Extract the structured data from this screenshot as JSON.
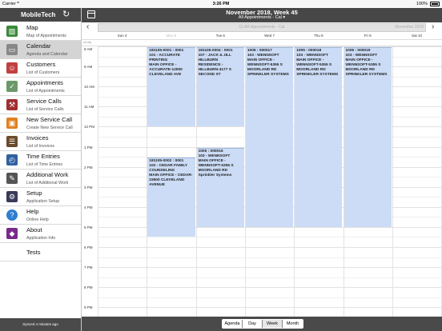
{
  "status_bar": {
    "carrier": "Carrier",
    "time": "3:26 PM",
    "battery": "100%"
  },
  "sidebar": {
    "app_title": "MobileTech",
    "items": [
      {
        "label": "Map",
        "sub": "Map of Appointments",
        "icon": "map-icon",
        "color": "#3a8a3a"
      },
      {
        "label": "Calendar",
        "sub": "Agenda and Calendar",
        "icon": "calendar-icon",
        "color": "#888888",
        "active": true
      },
      {
        "label": "Customers",
        "sub": "List of Customers",
        "icon": "customers-icon",
        "color": "#c04040"
      },
      {
        "label": "Appointments",
        "sub": "List of Appointments",
        "icon": "appointments-icon",
        "color": "#6a9a6a"
      },
      {
        "label": "Service Calls",
        "sub": "List of Service Calls",
        "icon": "tools-icon",
        "color": "#a03030"
      },
      {
        "label": "New Service Call",
        "sub": "Create New Service Call",
        "icon": "truck-icon",
        "color": "#e08020"
      },
      {
        "label": "Invoices",
        "sub": "List of Invoices",
        "icon": "invoice-icon",
        "color": "#6b4a2a"
      },
      {
        "label": "Time Entries",
        "sub": "List of Time Entries",
        "icon": "clock-icon",
        "color": "#3060a0"
      },
      {
        "label": "Additional Work",
        "sub": "List of Additional Work",
        "icon": "edit-icon",
        "color": "#555555"
      },
      {
        "label": "Setup",
        "sub": "Application Setup",
        "icon": "gear-icon",
        "color": "#3a3a5a"
      },
      {
        "label": "Help",
        "sub": "Online Help",
        "icon": "help-icon",
        "color": "#2f7fd0"
      },
      {
        "label": "About",
        "sub": "Application Info",
        "icon": "about-icon",
        "color": "#7a2a8a"
      },
      {
        "label": "Tests",
        "sub": "",
        "icon": "",
        "color": ""
      }
    ],
    "footer": "Synced 4 minutes ago"
  },
  "header": {
    "title": "November 2018, Week 45",
    "filter": "All Appointments - Cal ▾",
    "banner": "CLAR Appointments - Cal",
    "banner_right": "November  2018"
  },
  "calendar": {
    "days": [
      "Sun 4",
      "Mon 5",
      "Tue 6",
      "Wed 7",
      "Thu 8",
      "Fri 9",
      "Sat 10"
    ],
    "all_day_label": "all-day",
    "hours": [
      "8 AM",
      "9 AM",
      "10 AM",
      "11 AM",
      "12 PM",
      "1 PM",
      "2 PM",
      "3 PM",
      "4 PM",
      "5 PM",
      "6 PM",
      "7 PM",
      "8 PM",
      "9 PM"
    ],
    "events": [
      {
        "day": 1,
        "start": 8.0,
        "end": 12.0,
        "text": "181105-0001 : 0001\n101 - ACCURATE PRINTING\nMAIN OFFICE - ACCURATE-12500 CLEVELAND AVE"
      },
      {
        "day": 1,
        "start": 13.5,
        "end": 17.5,
        "text": "181105-0002 : 0001\n102 - CEDAR FAMILY COUNSELING\nMAIN OFFICE - CEDAR-15500 CLEVELAND AVENUE"
      },
      {
        "day": 2,
        "start": 8.0,
        "end": 12.0,
        "text": "181105-0004 : 0001\n107 - JACK & JILL HILLBURN\nRESIDENCE - HILLBURN-4177 S SECOND ST"
      },
      {
        "day": 2,
        "start": 13.0,
        "end": 17.0,
        "text": "1005 : 000015\n103 - WENNSOFT\nMAIN OFFICE - WENNSOFT-5355 S MOORLAND RD\nSprinkler Systems"
      },
      {
        "day": 3,
        "start": 8.0,
        "end": 17.0,
        "text": "1005 : 000017\n103 - WENNSOFT\nMAIN OFFICE - WENNSOFT-5355 S MOORLAND RD\nSPRINKLER SYSTEMS"
      },
      {
        "day": 4,
        "start": 8.0,
        "end": 17.0,
        "text": "1005 : 000018\n103 - WENNSOFT\nMAIN OFFICE - WENNSOFT-5355 S MOORLAND RD\nSPRINKLER SYSTEMS"
      },
      {
        "day": 5,
        "start": 8.0,
        "end": 17.0,
        "text": "1005 : 000019\n103 - WENNSOFT\nMAIN OFFICE - WENNSOFT-5355 S MOORLAND RD\nSPRINKLER SYSTEMS"
      }
    ]
  },
  "view_switcher": {
    "options": [
      "Agenda",
      "Day",
      "Week",
      "Month"
    ],
    "selected": "Week"
  },
  "colors": {
    "header_bg": "#474747",
    "event_bg": "#ccdcf6",
    "active_item": "#d4d4d4"
  }
}
